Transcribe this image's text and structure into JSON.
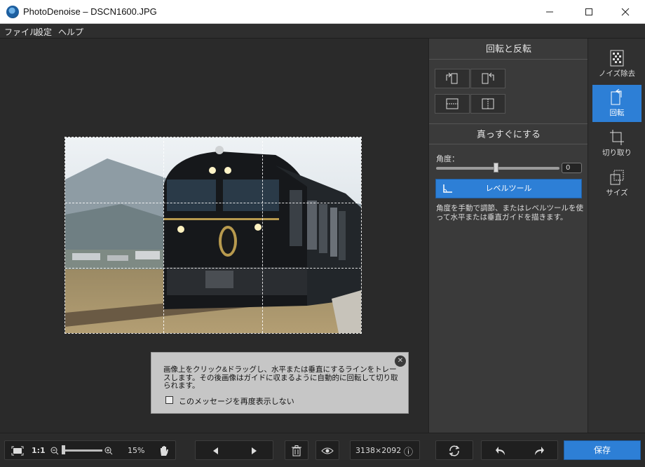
{
  "window": {
    "title": "PhotoDenoise – DSCN1600.JPG",
    "minimize": "—",
    "maximize": "☐",
    "close": "✕"
  },
  "menu": [
    "ファイル",
    "設定",
    "ヘルプ"
  ],
  "notice": {
    "text": "画像上をクリック&ドラッグし、水平または垂直にするラインをトレースします。その後画像はガイドに収まるように自動的に回転して切り取られます。",
    "checkbox_label": "このメッセージを再度表示しない",
    "close_icon": "✕"
  },
  "panel": {
    "rotate_flip_header": "回転と反転",
    "straighten_header": "真っすぐにする",
    "angle_label": "角度：",
    "angle_value": "0",
    "angle_slider_fraction": 0.5,
    "level_tool_label": "レベルツール",
    "description": "角度を手動で調節、またはレベルツールを使って水平または垂直ガイドを描きます。"
  },
  "sidebar": {
    "items": [
      {
        "label": "ノイズ除去",
        "icon": "noise-icon"
      },
      {
        "label": "回転",
        "icon": "rotate-icon",
        "active": true
      },
      {
        "label": "切り取り",
        "icon": "crop-icon"
      },
      {
        "label": "サイズ",
        "icon": "resize-icon"
      }
    ]
  },
  "bottom": {
    "actual_size": "1:1",
    "zoom_percent": "15%",
    "zoom_fraction": 0.05,
    "dimensions": "3138×2092",
    "info_icon": "ⓘ",
    "save_label": "保存"
  },
  "colors": {
    "accent": "#2d7fd6",
    "background": "#2b2b2b",
    "panel": "#3a3a3a",
    "notice": "#c6c6c6"
  }
}
